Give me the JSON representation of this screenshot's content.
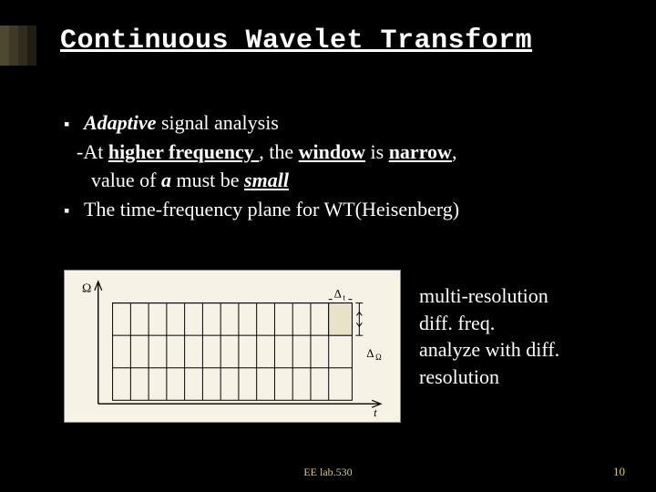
{
  "title": "Continuous Wavelet Transform",
  "bullets": {
    "b1_prefix": "Adaptive",
    "b1_rest": " signal analysis",
    "sub_at": "-At ",
    "sub_hf": "higher  frequency ",
    "sub_mid": ", the ",
    "sub_window": "window",
    "sub_is": " is ",
    "sub_narrow": "narrow",
    "sub_comma": ",",
    "sub2_a": "value of ",
    "sub2_b": "a ",
    "sub2_c": "must be ",
    "sub2_d": "small",
    "b2": "The time-frequency plane for WT(Heisenberg)"
  },
  "side": {
    "l1": "multi-resolution",
    "l2": "diff.   freq.",
    "l3": "analyze with diff.",
    "l4": "resolution"
  },
  "figure": {
    "omega": "Ω",
    "t": "t",
    "dt": "Δ",
    "dt_sub": "t",
    "dO": "Δ",
    "dO_sub": "Ω"
  },
  "footer": "EE lab.530",
  "slide_number": "10"
}
